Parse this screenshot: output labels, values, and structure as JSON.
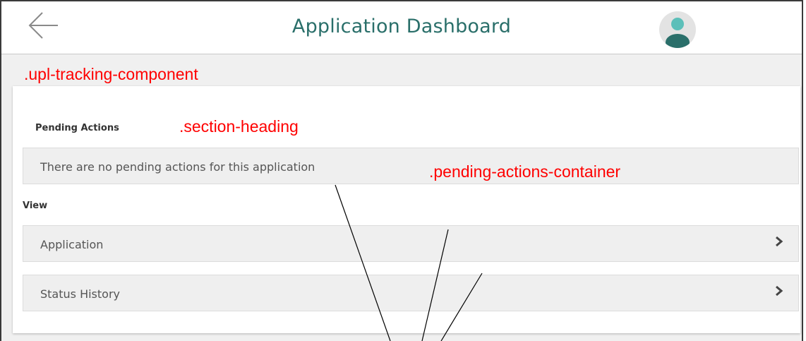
{
  "header": {
    "title": "Application Dashboard"
  },
  "annotations": {
    "component": ".upl-tracking-component",
    "section_heading": ".section-heading",
    "pending_container": ".pending-actions-container"
  },
  "pending": {
    "heading": "Pending Actions",
    "message": "There are no pending actions for this application"
  },
  "view": {
    "heading": "View",
    "items": [
      {
        "label": "Application"
      },
      {
        "label": "Status History"
      }
    ]
  },
  "colors": {
    "title": "#2a6f6a",
    "annotation": "#ff0000",
    "avatar_head": "#5cbfb9",
    "avatar_body": "#2a6f6a"
  }
}
